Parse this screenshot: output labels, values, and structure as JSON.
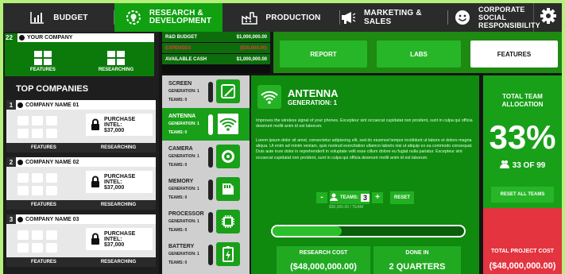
{
  "nav": {
    "tabs": [
      {
        "label": "BUDGET",
        "icon": "bar-chart-icon"
      },
      {
        "label": "RESEARCH & DEVELOPMENT",
        "line1": "RESEARCH &",
        "line2": "DEVELOPMENT",
        "icon": "lightbulb-gear-icon",
        "active": true
      },
      {
        "label": "PRODUCTION",
        "icon": "factory-icon"
      },
      {
        "label": "MARKETING & SALES",
        "icon": "megaphone-icon"
      },
      {
        "label": "CORPORATE SOCIAL RESPONSIBILITY",
        "line1": "CORPORATE SOCIAL",
        "line2": "RESPONSIBILITY",
        "icon": "smiley-icon"
      }
    ],
    "settings_icon": "gear-icon"
  },
  "your_company": {
    "number": "22",
    "name": "YOUR COMPANY",
    "features": "FEATURES",
    "researching": "RESEARCHING"
  },
  "top_companies": {
    "title": "TOP COMPANIES",
    "items": [
      {
        "rank": "1",
        "name": "COMPANY NAME 01",
        "intel_label": "PURCHASE INTEL:",
        "intel_price": "$37,000",
        "features": "FEATURES",
        "researching": "RESEARCHING"
      },
      {
        "rank": "2",
        "name": "COMPANY NAME 02",
        "intel_label": "PURCHASE INTEL:",
        "intel_price": "$37,000",
        "features": "FEATURES",
        "researching": "RESEARCHING"
      },
      {
        "rank": "3",
        "name": "COMPANY NAME 03",
        "intel_label": "PURCHASE INTEL:",
        "intel_price": "$37,000",
        "features": "FEATURES",
        "researching": "RESEARCHING"
      }
    ]
  },
  "budget": {
    "rows": [
      {
        "label": "R&D BUDGET",
        "value": "$1,000,000.00",
        "color": "#ffffff"
      },
      {
        "label": "EXPENSES",
        "value": "($30,000.00)",
        "color": "#e83a3a"
      },
      {
        "label": "AVAILABLE CASH",
        "value": "$1,000,000.00",
        "color": "#ffffff"
      }
    ]
  },
  "subtabs": {
    "report": "REPORT",
    "labs": "LABS",
    "features": "FEATURES"
  },
  "components": [
    {
      "name": "SCREEN",
      "gen": "GENERATION: 1",
      "teams": "TEAMS: 0",
      "icon": "screen-icon",
      "active": false
    },
    {
      "name": "ANTENNA",
      "gen": "GENERATION: 1",
      "teams": "TEAMS: 0",
      "icon": "wifi-icon",
      "active": true
    },
    {
      "name": "CAMERA",
      "gen": "GENERATION: 1",
      "teams": "TEAMS: 0",
      "icon": "camera-icon",
      "active": false
    },
    {
      "name": "MEMORY",
      "gen": "GENERATION: 1",
      "teams": "TEAMS: 0",
      "icon": "memory-card-icon",
      "active": false
    },
    {
      "name": "PROCESSOR",
      "gen": "GENERATION: 1",
      "teams": "TEAMS: 0",
      "icon": "chip-icon",
      "active": false
    },
    {
      "name": "BATTERY",
      "gen": "GENERATION: 1",
      "teams": "TEAMS: 0",
      "icon": "battery-icon",
      "active": false
    }
  ],
  "detail": {
    "name": "ANTENNA",
    "gen": "GENERATION: 1",
    "desc1": "Improves the wireless signal of your phones. Excepteur sint occaecat cupidatat non proident, sunt in culpa qui officia deserunt mollit anim id est laborum.",
    "desc2": "Lorem ipsum dolor sit amet, consectetur adipiscing elit, sed do eiusmod tempor incididunt ut labore et dolore magna aliqua. Ut enim ad minim veniam, quis nostrud exercitation ullamco laboris nisi ut aliquip ex ea commodo consequat. Duis aute irure dolor in reprehenderit in voluptate velit esse cillum dolore eu fugiat nulla pariatur. Excepteur sint occaecat cupidatat non proident, sunt in culpa qui officia deserunt mollit anim id est laborum.",
    "teams_label": "TEAMS:",
    "teams_value": "3",
    "minus": "-",
    "plus": "+",
    "reset": "RESET",
    "cost_per_team": "$30,000.00 / TEAM",
    "progress": 0.36,
    "research_cost_label": "RESEARCH COST",
    "research_cost": "($48,000,000.00)",
    "done_in_label": "DONE IN",
    "done_in": "2 QUARTERS"
  },
  "allocation": {
    "label1": "TOTAL TEAM",
    "label2": "ALLOCATION",
    "percent": "33%",
    "count": "33 OF 99",
    "reset_all": "RESET ALL TEAMS"
  },
  "project": {
    "label": "TOTAL PROJECT COST",
    "value": "($48,000,000.00)"
  },
  "colors": {
    "green": "#19a019",
    "dark_green": "#0f8a0f",
    "frame_bg": "#b4f07a",
    "red": "#e3343f"
  }
}
